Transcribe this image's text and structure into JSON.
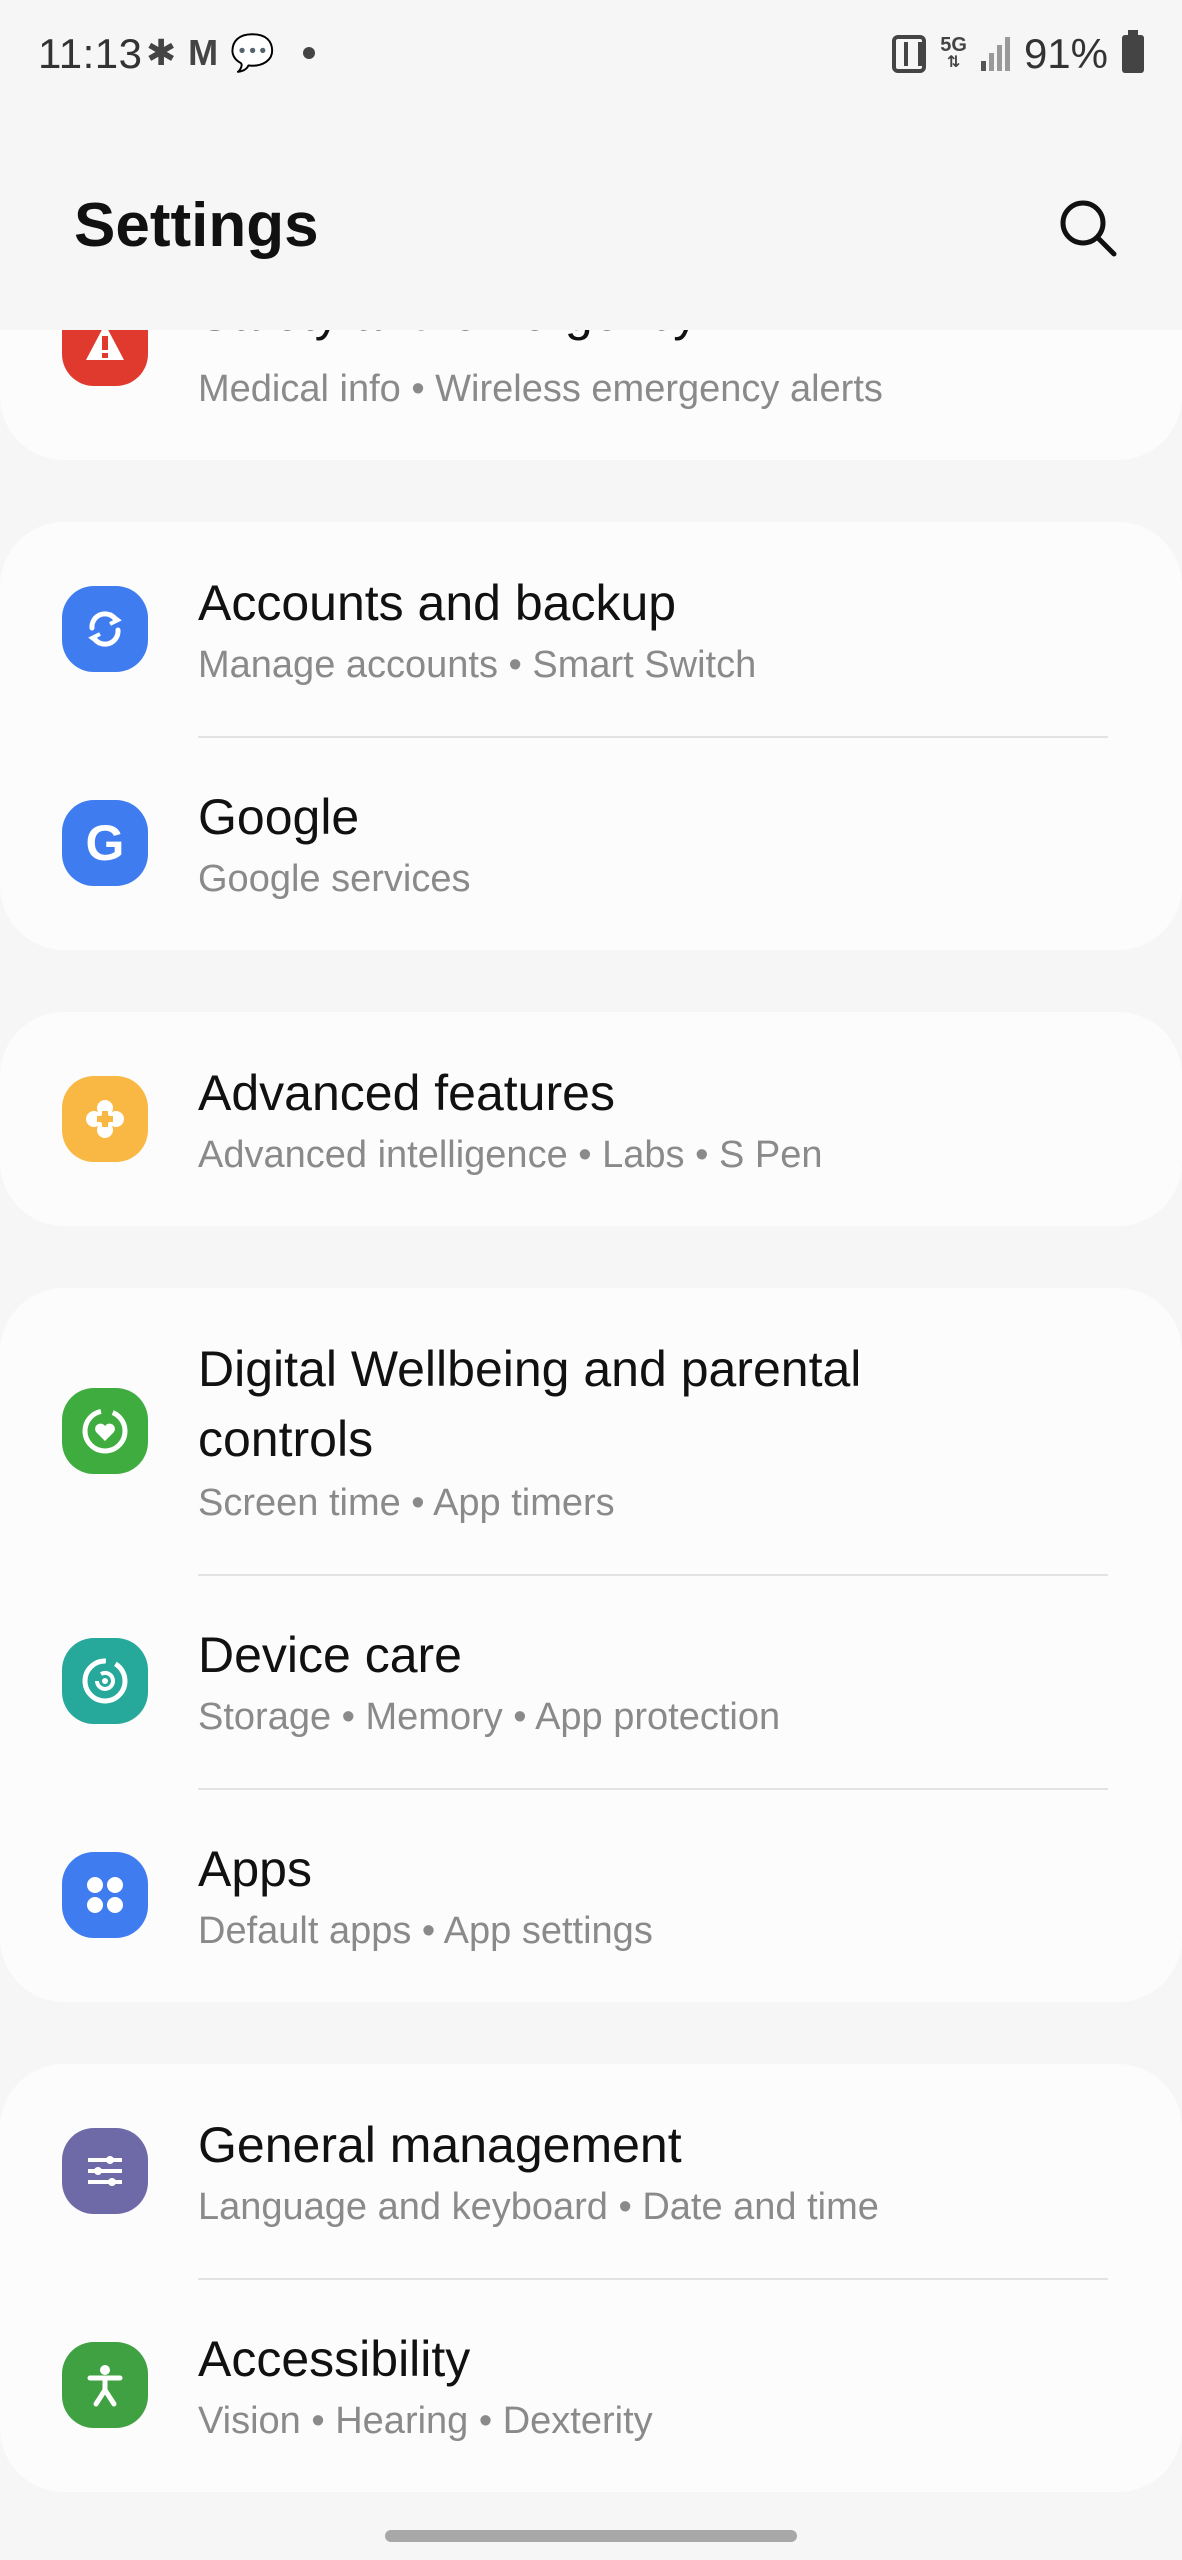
{
  "status_bar": {
    "time": "11:13",
    "network": "5G",
    "battery": "91%"
  },
  "header": {
    "title": "Settings"
  },
  "colors": {
    "background": "#f6f6f6",
    "card": "#fcfcfc",
    "secondary_text": "#8a8a8a"
  },
  "sections": [
    {
      "items": [
        {
          "title": "Safety and emergency",
          "subtitle": "Medical info  •  Wireless emergency alerts",
          "icon": "warning-icon",
          "color": "#e03a2f"
        }
      ]
    },
    {
      "items": [
        {
          "title": "Accounts and backup",
          "subtitle": "Manage accounts  •  Smart Switch",
          "icon": "sync-icon",
          "color": "#3e7cf0"
        },
        {
          "title": "Google",
          "subtitle": "Google services",
          "icon": "google-icon",
          "color": "#3e7cf0"
        }
      ]
    },
    {
      "items": [
        {
          "title": "Advanced features",
          "subtitle": "Advanced intelligence  •  Labs  •  S Pen",
          "icon": "puzzle-plus-icon",
          "color": "#f9b843"
        }
      ]
    },
    {
      "items": [
        {
          "title": "Digital Wellbeing and parental",
          "title_line2": "controls",
          "subtitle": "Screen time  •  App timers",
          "icon": "wellbeing-icon",
          "color": "#3fac3f"
        },
        {
          "title": "Device care",
          "subtitle": "Storage  •  Memory  •  App protection",
          "icon": "device-care-icon",
          "color": "#26a89a"
        },
        {
          "title": "Apps",
          "subtitle": "Default apps  •  App settings",
          "icon": "apps-grid-icon",
          "color": "#3e7cf0"
        }
      ]
    },
    {
      "items": [
        {
          "title": "General management",
          "subtitle": "Language and keyboard  •  Date and time",
          "icon": "sliders-icon",
          "color": "#6e6aa8"
        },
        {
          "title": "Accessibility",
          "subtitle": "Vision  •  Hearing  •  Dexterity",
          "icon": "accessibility-icon",
          "color": "#3fa142"
        }
      ]
    }
  ]
}
